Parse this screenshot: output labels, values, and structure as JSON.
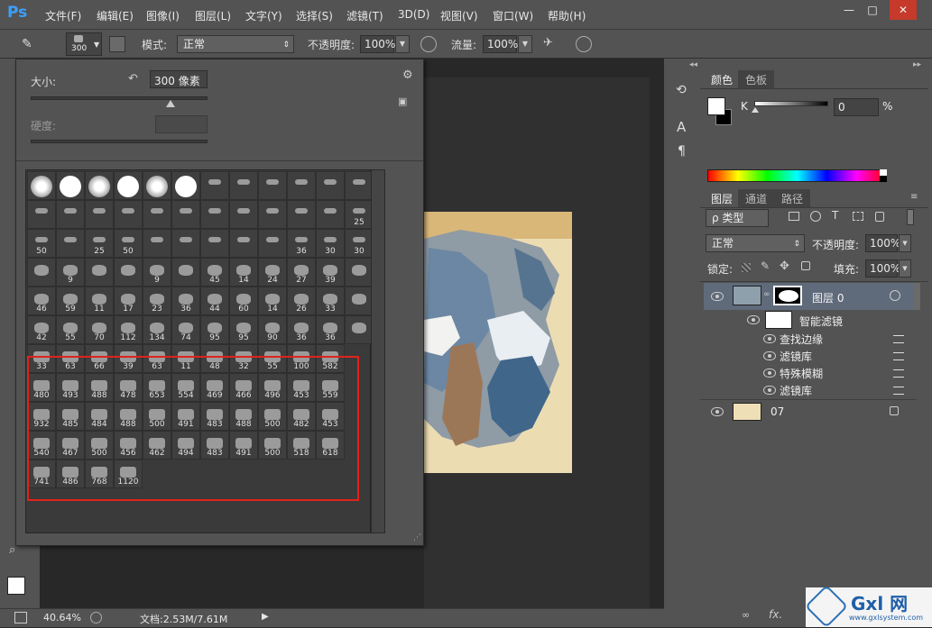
{
  "app": {
    "logo": "Ps"
  },
  "menu": [
    "文件(F)",
    "编辑(E)",
    "图像(I)",
    "图层(L)",
    "文字(Y)",
    "选择(S)",
    "滤镜(T)",
    "3D(D)",
    "视图(V)",
    "窗口(W)",
    "帮助(H)"
  ],
  "window_controls": [
    "—",
    "□",
    "✕"
  ],
  "options": {
    "brush_size": "300",
    "mode_label": "模式:",
    "mode_value": "正常",
    "opacity_label": "不透明度:",
    "opacity_value": "100%",
    "flow_label": "流量:",
    "flow_value": "100%"
  },
  "picker": {
    "size_label": "大小:",
    "size_value": "300 像素",
    "hardness_label": "硬度:",
    "rows": [
      [
        "",
        "",
        "",
        "",
        "",
        "",
        "",
        "",
        "",
        "",
        "",
        ""
      ],
      [
        "",
        "",
        "",
        "",
        "",
        "",
        "",
        "",
        "",
        "",
        "",
        "25"
      ],
      [
        "50",
        "",
        "25",
        "50",
        "",
        "",
        "",
        "",
        "",
        "36",
        "30",
        "30"
      ],
      [
        "",
        "9",
        "",
        "",
        "9",
        "",
        "45",
        "14",
        "24",
        "27",
        "39",
        ""
      ],
      [
        "46",
        "59",
        "11",
        "17",
        "23",
        "36",
        "44",
        "60",
        "14",
        "26",
        "33",
        ""
      ],
      [
        "42",
        "55",
        "70",
        "112",
        "134",
        "74",
        "95",
        "95",
        "90",
        "36",
        "36",
        ""
      ],
      [
        "33",
        "63",
        "66",
        "39",
        "63",
        "11",
        "48",
        "32",
        "55",
        "100",
        "582"
      ],
      [
        "480",
        "493",
        "488",
        "478",
        "653",
        "554",
        "469",
        "466",
        "496",
        "453",
        "559"
      ],
      [
        "932",
        "485",
        "484",
        "488",
        "500",
        "491",
        "483",
        "488",
        "500",
        "482",
        "453"
      ],
      [
        "540",
        "467",
        "500",
        "456",
        "462",
        "494",
        "483",
        "491",
        "500",
        "518",
        "618"
      ],
      [
        "741",
        "486",
        "768",
        "1120"
      ]
    ]
  },
  "colors": {
    "highlight": "#e0221b",
    "accent": "#3aa0ff"
  },
  "statusbar": {
    "zoom": "40.64%",
    "doc": "文档:2.53M/7.61M"
  },
  "color_panel": {
    "tabs": [
      "颜色",
      "色板"
    ],
    "channel": "K",
    "value": "0",
    "unit": "%"
  },
  "layers_panel": {
    "tabs": [
      "图层",
      "通道",
      "路径"
    ],
    "filter_type": "ρ 类型",
    "blend": "正常",
    "opacity_label": "不透明度:",
    "opacity": "100%",
    "lock_label": "锁定:",
    "fill_label": "填充:",
    "fill": "100%",
    "layer0": "图层 0",
    "smart_filters": "智能滤镜",
    "filters": [
      "查找边缘",
      "滤镜库",
      "特殊模糊",
      "滤镜库"
    ],
    "layer07": "07"
  },
  "watermark": {
    "brand": "Gxl 网",
    "url": "www.gxlsystem.com"
  }
}
